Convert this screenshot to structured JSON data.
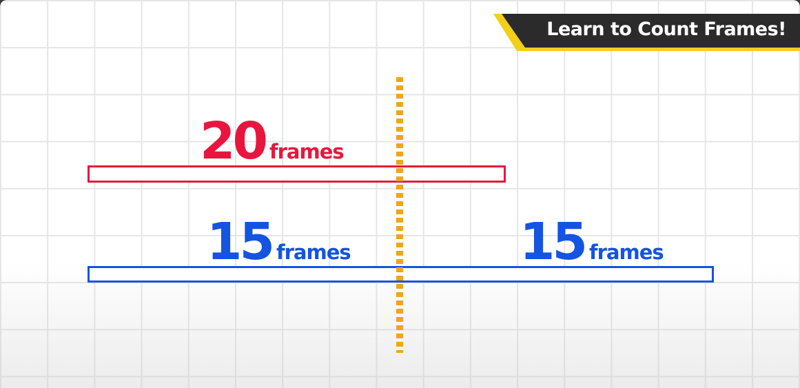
{
  "banner": {
    "title": "Learn to Count Frames!"
  },
  "bars": {
    "red": {
      "number": "20",
      "unit": "frames",
      "frames": 20
    },
    "blue": {
      "frames": 30,
      "segments": [
        {
          "number": "15",
          "unit": "frames",
          "frames": 15
        },
        {
          "number": "15",
          "unit": "frames",
          "frames": 15
        }
      ]
    }
  },
  "colors": {
    "red": "#e8163f",
    "blue": "#1454e0",
    "divider": "#f0a51e",
    "banner_accent": "#f2d01a",
    "banner_bg": "#2b2b2b"
  }
}
